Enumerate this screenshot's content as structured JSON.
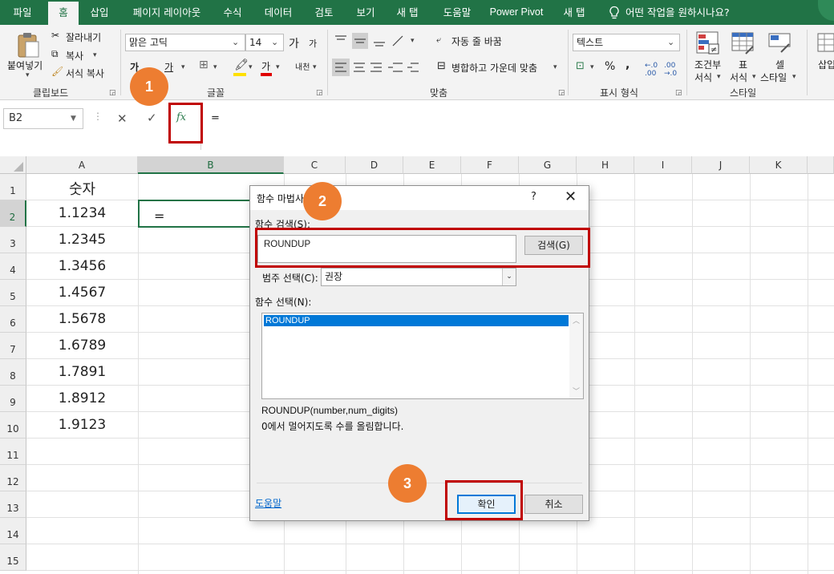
{
  "menu": {
    "items": [
      "파일",
      "홈",
      "삽입",
      "페이지 레이아웃",
      "수식",
      "데이터",
      "검토",
      "보기",
      "새 탭",
      "도움말",
      "Power Pivot",
      "새 탭"
    ],
    "active_index": 1,
    "tell_me": "어떤 작업을 원하시나요?"
  },
  "ribbon": {
    "clipboard": {
      "paste": "붙여넣기",
      "cut": "잘라내기",
      "copy": "복사",
      "format_painter": "서식 복사",
      "label": "클립보드"
    },
    "font": {
      "name": "맑은 고딕",
      "size": "14",
      "grow": "가",
      "shrink": "가",
      "bold": "가",
      "underline": "가",
      "font_color": "가",
      "phonetic": "내천",
      "label": "글꼴"
    },
    "alignment": {
      "wrap_text": "자동 줄 바꿈",
      "merge_center": "병합하고 가운데 맞춤",
      "label": "맞춤"
    },
    "number": {
      "format": "텍스트",
      "percent": "%",
      "comma": ",",
      "label": "표시 형식"
    },
    "styles": {
      "conditional_line1": "조건부",
      "conditional_line2": "서식",
      "table_line1": "표",
      "table_line2": "서식",
      "cell_line1": "셀",
      "cell_line2": "스타일",
      "label": "스타일"
    },
    "cells": {
      "insert": "삽입"
    }
  },
  "formula_bar": {
    "name_box": "B2",
    "fx": "fx",
    "content": "="
  },
  "grid": {
    "columns": [
      "A",
      "B",
      "C",
      "D",
      "E",
      "F",
      "G",
      "H",
      "I",
      "J",
      "K"
    ],
    "rows": [
      "1",
      "2",
      "3",
      "4",
      "5",
      "6",
      "7",
      "8",
      "9",
      "10",
      "11",
      "12",
      "13",
      "14",
      "15"
    ],
    "column_a": [
      "숫자",
      "1.1234",
      "1.2345",
      "1.3456",
      "1.4567",
      "1.5678",
      "1.6789",
      "1.7891",
      "1.8912",
      "1.9123"
    ],
    "b2": "=",
    "selected_cell": "B2"
  },
  "dialog": {
    "title": "함수 마법사",
    "help_symbol": "?",
    "close_symbol": "✕",
    "search_label": "함수 검색(S):",
    "search_value": "ROUNDUP",
    "search_button": "검색(G)",
    "category_label": "범주 선택(C):",
    "category_value": "권장",
    "function_label": "함수 선택(N):",
    "function_item": "ROUNDUP",
    "syntax": "ROUNDUP(number,num_digits)",
    "description": "0에서 멀어지도록 수를 올림합니다.",
    "help_link": "도움말",
    "ok_button": "확인",
    "cancel_button": "취소"
  },
  "annotations": {
    "step1": "1",
    "step2": "2",
    "step3": "3",
    "highlight_color": "#c00000",
    "badge_color": "#ed7d31"
  },
  "colors": {
    "excel_green": "#217346",
    "selection_blue": "#0078d7"
  }
}
